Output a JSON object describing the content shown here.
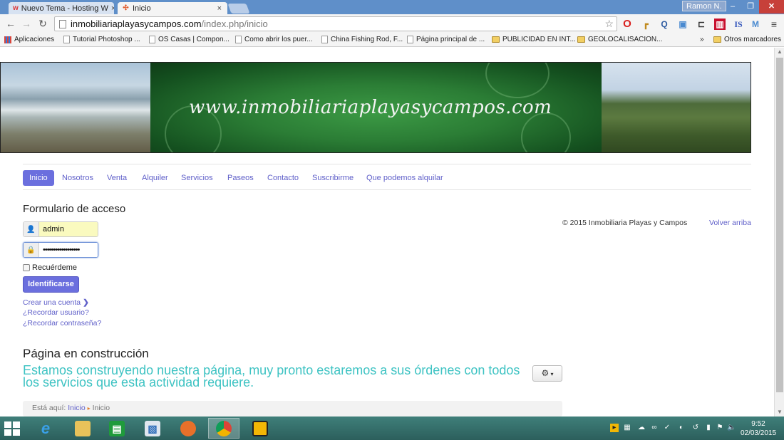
{
  "browser": {
    "tabs": [
      {
        "title": "Nuevo Tema - Hosting W",
        "favicon": "w",
        "active": false
      },
      {
        "title": "Inicio",
        "favicon": "joomla",
        "active": true
      }
    ],
    "user": "Ramon N.",
    "url_host": "inmobiliariaplayasycampos.com",
    "url_path": "/index.php/inicio",
    "bookmarks": [
      {
        "label": "Aplicaciones",
        "type": "apps"
      },
      {
        "label": "Tutorial Photoshop ...",
        "type": "page"
      },
      {
        "label": "OS Casas | Compon...",
        "type": "page"
      },
      {
        "label": "Como abrir los puer...",
        "type": "page"
      },
      {
        "label": "China Fishing Rod, F...",
        "type": "page"
      },
      {
        "label": "Página principal de ...",
        "type": "page"
      },
      {
        "label": "PUBLICIDAD EN INT...",
        "type": "folder"
      },
      {
        "label": "GEOLOCALISACION...",
        "type": "folder"
      },
      {
        "label": "»",
        "type": "more"
      },
      {
        "label": "Otros marcadores",
        "type": "folder"
      }
    ]
  },
  "site": {
    "banner_text": "www.inmobiliariaplayasycampos.com",
    "nav": [
      "Inicio",
      "Nosotros",
      "Venta",
      "Alquiler",
      "Servicios",
      "Paseos",
      "Contacto",
      "Suscribirme",
      "Que podemos alquilar"
    ],
    "login": {
      "title": "Formulario de acceso",
      "username": "admin",
      "password_mask": "••••••••••••••••••",
      "remember_label": "Recuérdeme",
      "submit_label": "Identificarse",
      "create_account": "Crear una cuenta",
      "forgot_user": "¿Recordar usuario?",
      "forgot_password": "¿Recordar contraseña?"
    },
    "footer": {
      "copyright": "© 2015 Inmobiliaria Playas y Campos",
      "back_to_top": "Volver arriba"
    },
    "content": {
      "title": "Página en construcción",
      "text": "Estamos construyendo nuestra página, muy pronto estaremos a sus órdenes con todos los servicios que esta actividad requiere."
    },
    "breadcrumb": {
      "label": "Está aquí:",
      "link": "Inicio",
      "current": "Inicio"
    }
  },
  "taskbar": {
    "time": "9:52",
    "date": "02/03/2015"
  },
  "colors": {
    "accent": "#6b6fde",
    "link": "#5f5fc9",
    "teal_text": "#3ec3c3"
  }
}
